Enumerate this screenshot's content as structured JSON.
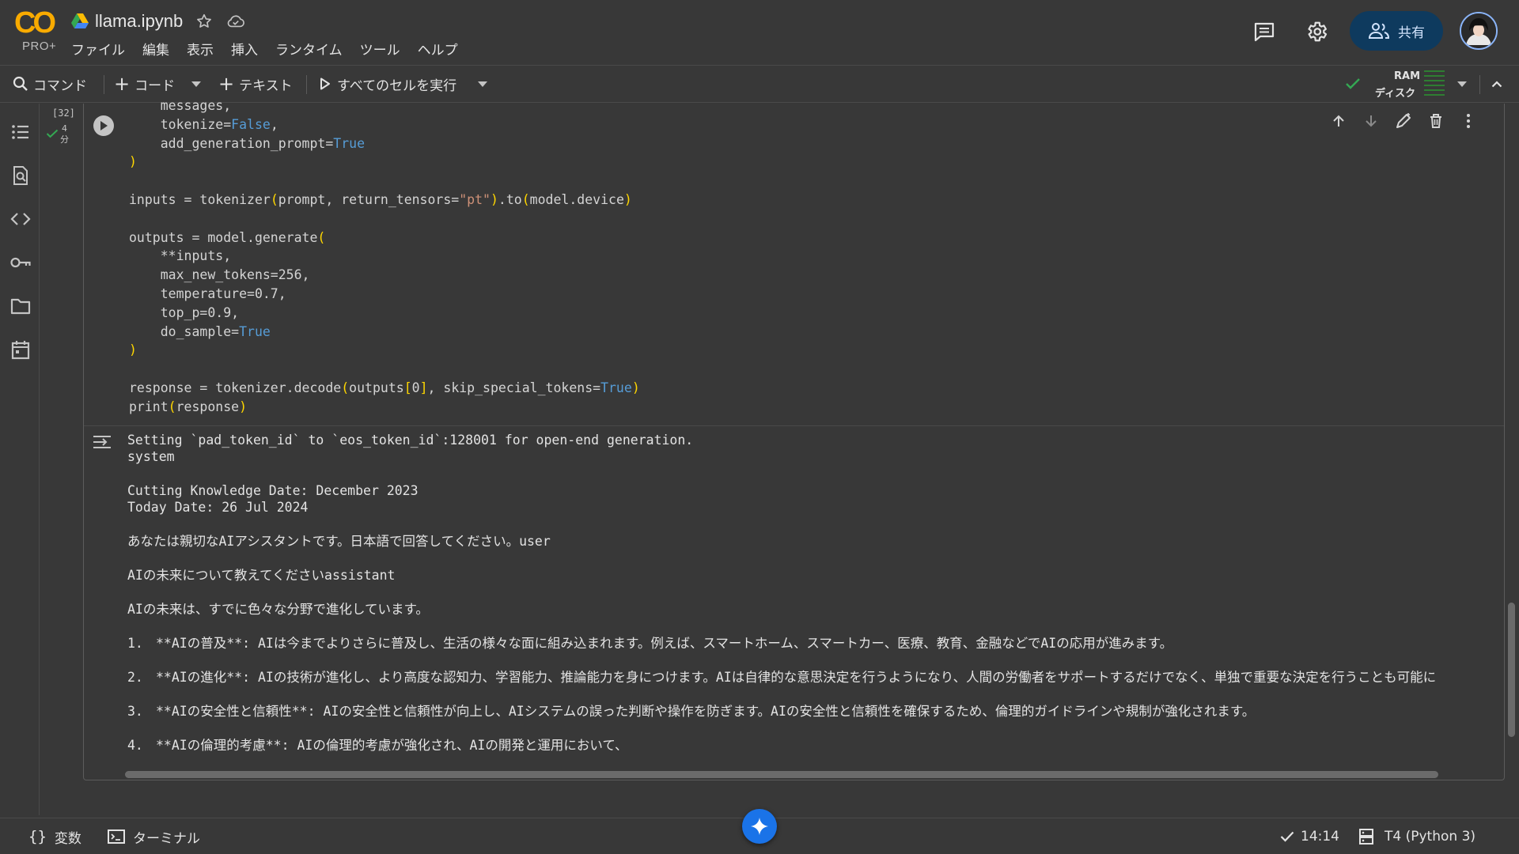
{
  "colors": {
    "background": "#383838",
    "accent": "#1a73e8",
    "share_bg": "#0e3a5e",
    "logo": "#f9ab00",
    "keyword": "#569cd6",
    "string": "#ce9178",
    "bracket": "#ffd700",
    "ok_green": "#34a853"
  },
  "header": {
    "logo_text": "CO",
    "logo_sub": "PRO+",
    "notebook_title": "llama.ipynb",
    "menu": [
      "ファイル",
      "編集",
      "表示",
      "挿入",
      "ランタイム",
      "ツール",
      "ヘルプ"
    ],
    "share_label": "共有"
  },
  "toolbar": {
    "command_label": "コマンド",
    "code_label": "コード",
    "text_label": "テキスト",
    "run_all_label": "すべてのセルを実行",
    "ram_label": "RAM",
    "disk_label": "ディスク"
  },
  "sidebar_icons": [
    "toc-icon",
    "find-icon",
    "code-snippets-icon",
    "secrets-key-icon",
    "files-folder-icon",
    "calendar-icon"
  ],
  "cell": {
    "exec_count": "[32]",
    "exec_time_num": "4",
    "exec_time_unit": "分",
    "code_lines": [
      "    messages,",
      "    tokenize=False,",
      "    add_generation_prompt=True",
      ")",
      "",
      "inputs = tokenizer(prompt, return_tensors=\"pt\").to(model.device)",
      "",
      "outputs = model.generate(",
      "    **inputs,",
      "    max_new_tokens=256,",
      "    temperature=0.7,",
      "    top_p=0.9,",
      "    do_sample=True",
      ")",
      "",
      "response = tokenizer.decode(outputs[0], skip_special_tokens=True)",
      "print(response)"
    ],
    "output": {
      "line1": "Setting `pad_token_id` to `eos_token_id`:128001 for open-end generation.",
      "line2": "system",
      "line3": "Cutting Knowledge Date: December 2023",
      "line4": "Today Date: 26 Jul 2024",
      "line5": "あなたは親切なAIアシスタントです。日本語で回答してください。user",
      "line6": "AIの未来について教えてくださいassistant",
      "line7": "AIの未来は、すでに色々な分野で進化しています。",
      "list": [
        {
          "n": "1.",
          "text": "**AIの普及**: AIは今までよりさらに普及し、生活の様々な面に組み込まれます。例えば、スマートホーム、スマートカー、医療、教育、金融などでAIの応用が進みます。"
        },
        {
          "n": "2.",
          "text": "**AIの進化**: AIの技術が進化し、より高度な認知力、学習能力、推論能力を身につけます。AIは自律的な意思決定を行うようになり、人間の労働者をサポートするだけでなく、単独で重要な決定を行うことも可能に"
        },
        {
          "n": "3.",
          "text": "**AIの安全性と信頼性**: AIの安全性と信頼性が向上し、AIシステムの誤った判断や操作を防ぎます。AIの安全性と信頼性を確保するため、倫理的ガイドラインや規制が強化されます。"
        },
        {
          "n": "4.",
          "text": "**AIの倫理的考慮**: AIの倫理的考慮が強化され、AIの開発と運用において、"
        }
      ]
    }
  },
  "statusbar": {
    "variables_label": "変数",
    "terminal_label": "ターミナル",
    "time": "14:14",
    "runtime": "T4 (Python 3)"
  }
}
